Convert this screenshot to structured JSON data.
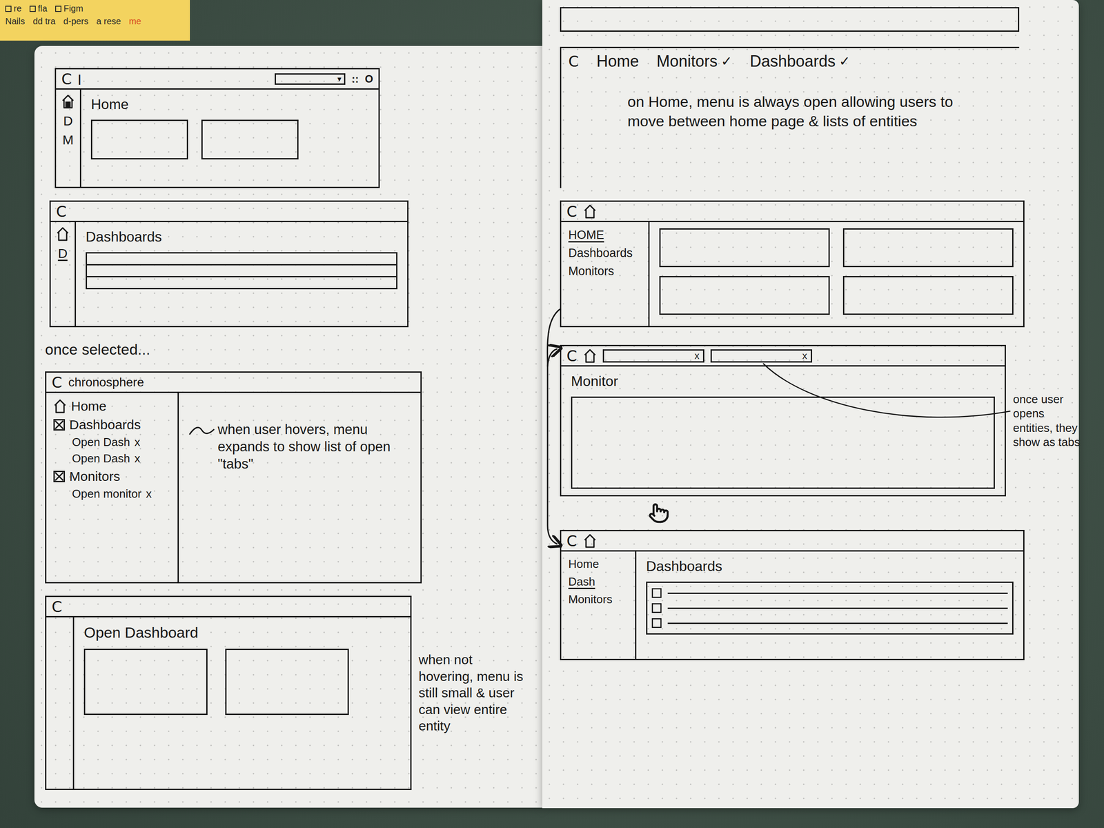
{
  "sticky_note": {
    "items": [
      {
        "label": "re",
        "checked": false
      },
      {
        "label": "fla",
        "checked": false
      },
      {
        "label": "Figm",
        "checked": false
      }
    ],
    "lines": [
      "Nails",
      "dd tra",
      "d-pers",
      "a rese"
    ],
    "footer": "me"
  },
  "left_page": {
    "home_sketch": {
      "logo": "C",
      "cursor": "|",
      "search_caret": "▾",
      "header_icons": [
        "::",
        "O"
      ],
      "home_selected": true,
      "rail": [
        {
          "label": "D",
          "selected": false
        },
        {
          "label": "M",
          "selected": false
        }
      ],
      "title": "Home"
    },
    "dashboards_sketch": {
      "logo": "C",
      "home_selected": false,
      "rail": [
        {
          "label": "D",
          "selected": true
        }
      ],
      "title": "Dashboards"
    },
    "caption": "once selected...",
    "hover_sketch": {
      "logo": "C",
      "brand": "chronosphere",
      "menu": [
        {
          "label": "Home",
          "kind": "home",
          "checked": false,
          "tabs": []
        },
        {
          "label": "Dashboards",
          "kind": "group",
          "checked": true,
          "tabs": [
            {
              "label": "Open Dash",
              "close": "x"
            },
            {
              "label": "Open Dash",
              "close": "x"
            }
          ]
        },
        {
          "label": "Monitors",
          "kind": "group",
          "checked": true,
          "tabs": [
            {
              "label": "Open monitor",
              "close": "x"
            }
          ]
        }
      ],
      "note": "when user hovers, menu expands to show list of open \"tabs\""
    },
    "collapsed_sketch": {
      "logo": "C",
      "title": "Open Dashboard",
      "note": "when not hovering, menu is still small & user can view entire entity"
    }
  },
  "right_page": {
    "top_nav_sketch": {
      "logo": "C",
      "items": [
        {
          "label": "Home",
          "caret": ""
        },
        {
          "label": "Monitors",
          "caret": "✓"
        },
        {
          "label": "Dashboards",
          "caret": "✓"
        }
      ],
      "note": "on Home, menu is always open allowing users to move between home page & lists of entities"
    },
    "home_open_sketch": {
      "logo": "C",
      "menu": [
        {
          "label": "HOME",
          "selected": true
        },
        {
          "label": "Dashboards",
          "selected": false
        },
        {
          "label": "Monitors",
          "selected": false
        }
      ]
    },
    "tabs_sketch": {
      "logo": "C",
      "tabs": [
        {
          "close": "x"
        },
        {
          "close": "x"
        }
      ],
      "title": "Monitor",
      "note": "once user opens entities, they show as tabs"
    },
    "list_sketch": {
      "logo": "C",
      "menu": [
        {
          "label": "Home",
          "selected": false
        },
        {
          "label": "Dash",
          "selected": true
        },
        {
          "label": "Monitors",
          "selected": false
        }
      ],
      "title": "Dashboards",
      "rows": [
        {
          "checked": false
        },
        {
          "checked": false
        },
        {
          "checked": false
        }
      ]
    }
  }
}
